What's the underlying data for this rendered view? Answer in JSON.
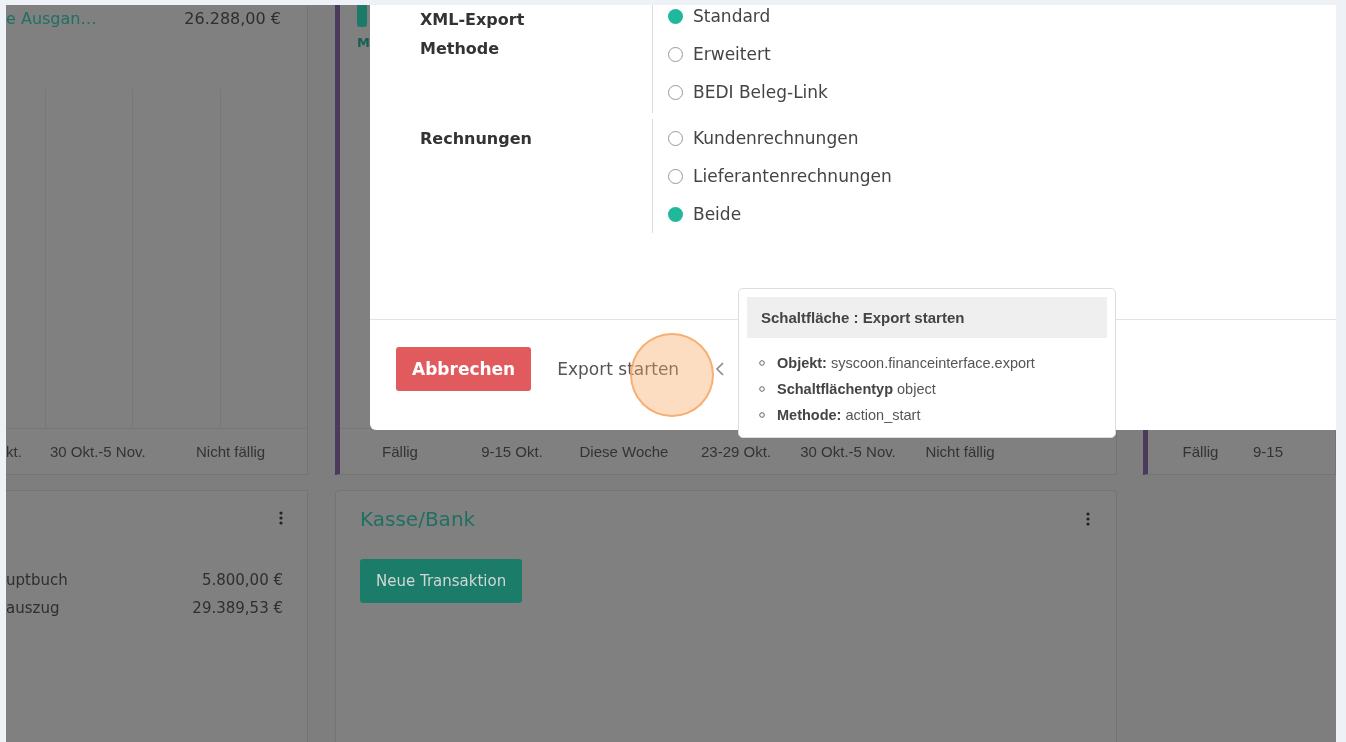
{
  "dashboard": {
    "top_left_card": {
      "title": "e Ausgan…",
      "amount": "26.288,00 €",
      "columns": [
        "kt.",
        "30 Okt.-5 Nov.",
        "Nicht fällig"
      ]
    },
    "top_middle_card": {
      "link": "M",
      "columns": [
        "Fällig",
        "9-15 Okt.",
        "Diese Woche",
        "23-29 Okt.",
        "30 Okt.-5 Nov.",
        "Nicht fällig"
      ]
    },
    "top_right_card": {
      "columns": [
        "Fällig",
        "9-15"
      ]
    },
    "ledger_card": {
      "rows": [
        {
          "label": "uptbuch",
          "amount": "5.800,00 €"
        },
        {
          "label": "auszug",
          "amount": "29.389,53 €"
        }
      ]
    },
    "bank_card": {
      "title": "Kasse/Bank",
      "button": "Neue Transaktion"
    }
  },
  "dialog": {
    "groups": [
      {
        "label": "XML-Export Methode",
        "options": [
          {
            "label": "Standard",
            "selected": true
          },
          {
            "label": "Erweitert",
            "selected": false
          },
          {
            "label": "BEDI Beleg-Link",
            "selected": false
          }
        ]
      },
      {
        "label": "Rechnungen",
        "options": [
          {
            "label": "Kundenrechnungen",
            "selected": false
          },
          {
            "label": "Lieferantenrechnungen",
            "selected": false
          },
          {
            "label": "Beide",
            "selected": true
          }
        ]
      }
    ],
    "cancel_button": "Abbrechen",
    "export_button": "Export starten"
  },
  "tooltip": {
    "title": "Schaltfläche : Export starten",
    "items": [
      {
        "key": "Objekt:",
        "value": "syscoon.financeinterface.export"
      },
      {
        "key": "Schaltflächentyp",
        "value": "object"
      },
      {
        "key": "Methode:",
        "value": "action_start"
      }
    ]
  }
}
